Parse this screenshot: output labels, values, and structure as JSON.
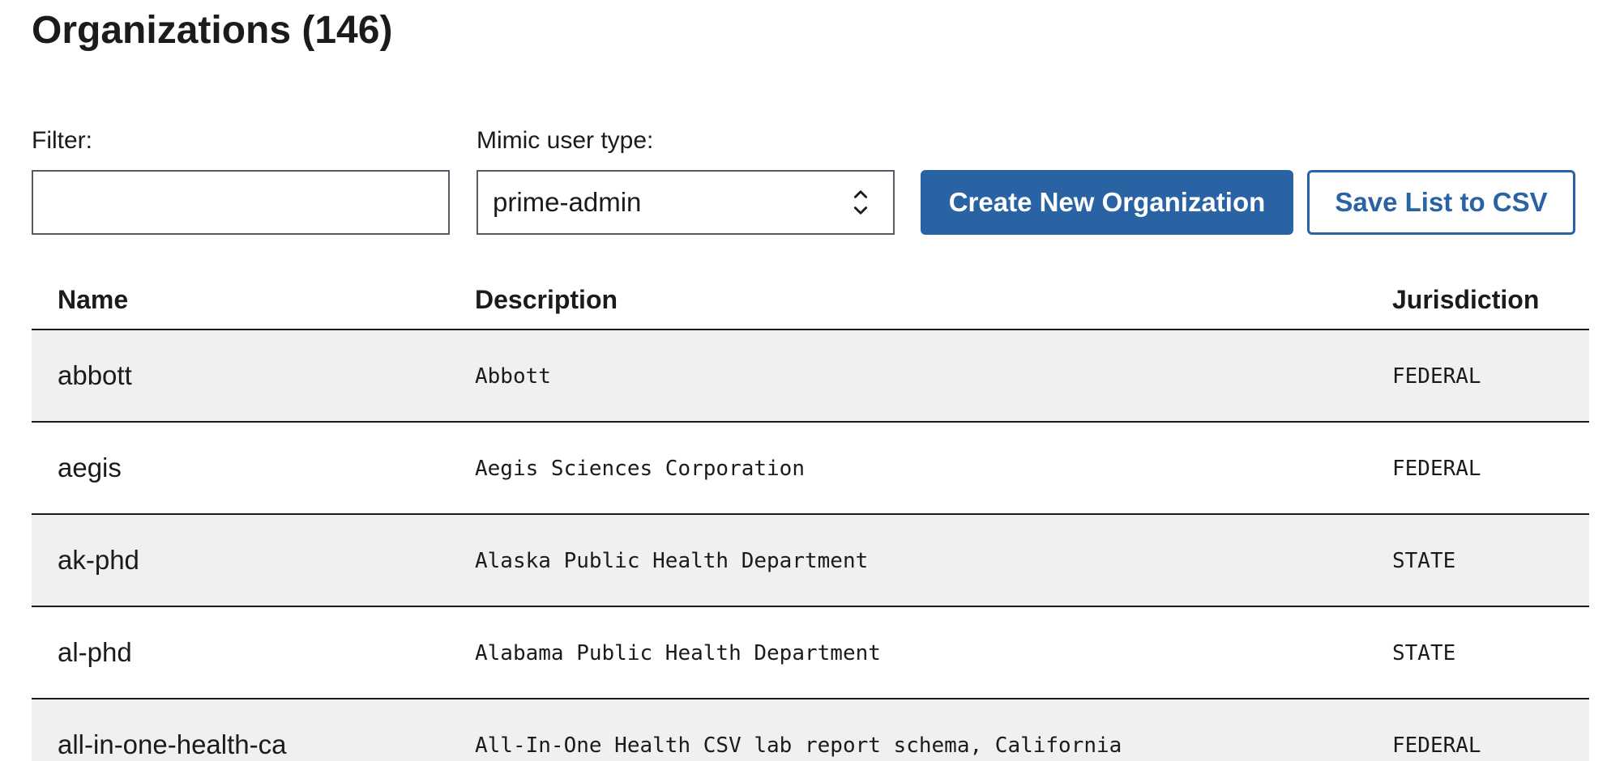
{
  "page": {
    "title": "Organizations (146)"
  },
  "filter": {
    "label": "Filter:",
    "value": "",
    "placeholder": ""
  },
  "mimic": {
    "label": "Mimic user type:",
    "selected": "prime-admin"
  },
  "buttons": {
    "create": "Create New Organization",
    "save_csv": "Save List to CSV"
  },
  "table": {
    "headers": {
      "name": "Name",
      "description": "Description",
      "jurisdiction": "Jurisdiction"
    },
    "rows": [
      {
        "name": "abbott",
        "description": "Abbott",
        "jurisdiction": "FEDERAL"
      },
      {
        "name": "aegis",
        "description": "Aegis Sciences Corporation",
        "jurisdiction": "FEDERAL"
      },
      {
        "name": "ak-phd",
        "description": "Alaska Public Health Department",
        "jurisdiction": "STATE"
      },
      {
        "name": "al-phd",
        "description": "Alabama Public Health Department",
        "jurisdiction": "STATE"
      },
      {
        "name": "all-in-one-health-ca",
        "description": "All-In-One Health CSV lab report schema, California",
        "jurisdiction": "FEDERAL"
      }
    ]
  },
  "colors": {
    "primary": "#2a63a4",
    "row_shade": "#f0f0f0",
    "text": "#1b1b1b",
    "border": "#565c65"
  },
  "icons": {
    "select": "chevron-up-down-icon"
  }
}
